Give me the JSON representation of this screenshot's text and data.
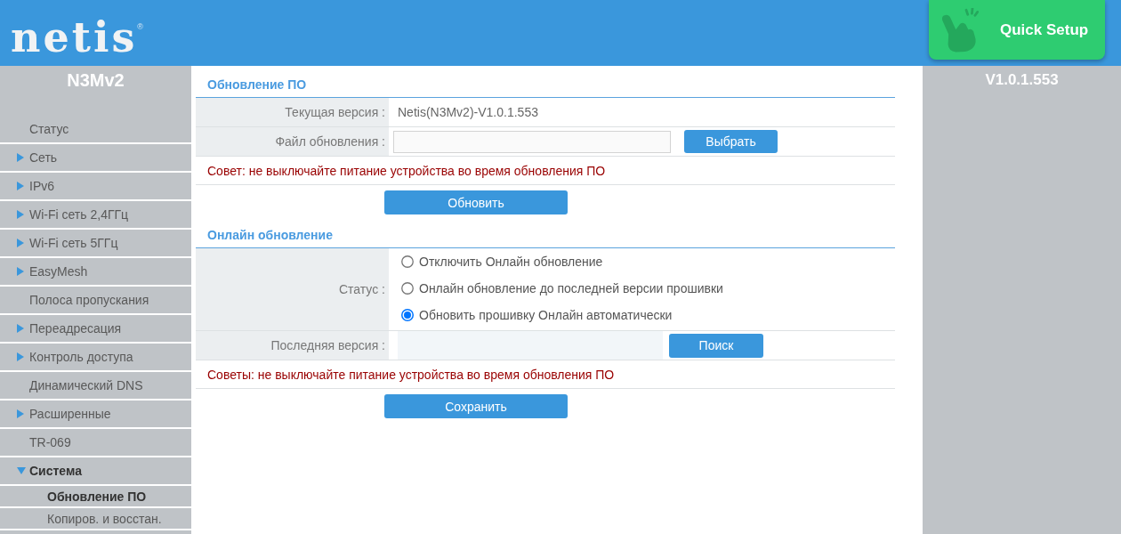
{
  "header": {
    "logo": "netis",
    "logo_mark": "®",
    "quick_setup": "Quick Setup"
  },
  "sidebar": {
    "model": "N3Mv2",
    "items": [
      {
        "kind": "page",
        "label": "Статус"
      },
      {
        "kind": "group",
        "label": "Сеть",
        "expanded": false
      },
      {
        "kind": "group",
        "label": "IPv6",
        "expanded": false
      },
      {
        "kind": "group",
        "label": "Wi-Fi сеть 2,4ГГц",
        "expanded": false
      },
      {
        "kind": "group",
        "label": "Wi-Fi сеть 5ГГц",
        "expanded": false
      },
      {
        "kind": "group",
        "label": "EasyMesh",
        "expanded": false
      },
      {
        "kind": "page",
        "label": "Полоса пропускания"
      },
      {
        "kind": "group",
        "label": "Переадресация",
        "expanded": false
      },
      {
        "kind": "group",
        "label": "Контроль доступа",
        "expanded": false
      },
      {
        "kind": "page",
        "label": "Динамический DNS"
      },
      {
        "kind": "group",
        "label": "Расширенные",
        "expanded": false
      },
      {
        "kind": "page",
        "label": "TR-069"
      },
      {
        "kind": "group",
        "label": "Система",
        "expanded": true,
        "children": [
          {
            "label": "Обновление ПО",
            "selected": true
          },
          {
            "label": "Копиров. и восстан.",
            "selected": false
          }
        ]
      }
    ]
  },
  "content": {
    "sections": [
      {
        "title": "Обновление ПО",
        "rows": [
          {
            "kind": "text",
            "label": "Текущая версия :",
            "value": "Netis(N3Mv2)-V1.0.1.553"
          },
          {
            "kind": "file",
            "label": "Файл обновления :",
            "button": "Выбрать"
          }
        ],
        "tip": "Совет: не выключайте питание устройства во время обновления ПО",
        "button": "Обновить"
      },
      {
        "title": "Онлайн обновление",
        "rows": [
          {
            "kind": "radio",
            "label": "Статус :",
            "options": [
              {
                "label": "Отключить Онлайн обновление",
                "selected": false
              },
              {
                "label": "Онлайн обновление до последней версии прошивки",
                "selected": false
              },
              {
                "label": "Обновить прошивку Онлайн автоматически",
                "selected": true
              }
            ]
          },
          {
            "kind": "search",
            "label": "Последняя версия :",
            "button": "Поиск"
          }
        ],
        "tip": "Советы: не выключайте питание устройства во время обновления ПО",
        "button": "Сохранить"
      }
    ]
  },
  "right_panel": {
    "version": "V1.0.1.553"
  }
}
